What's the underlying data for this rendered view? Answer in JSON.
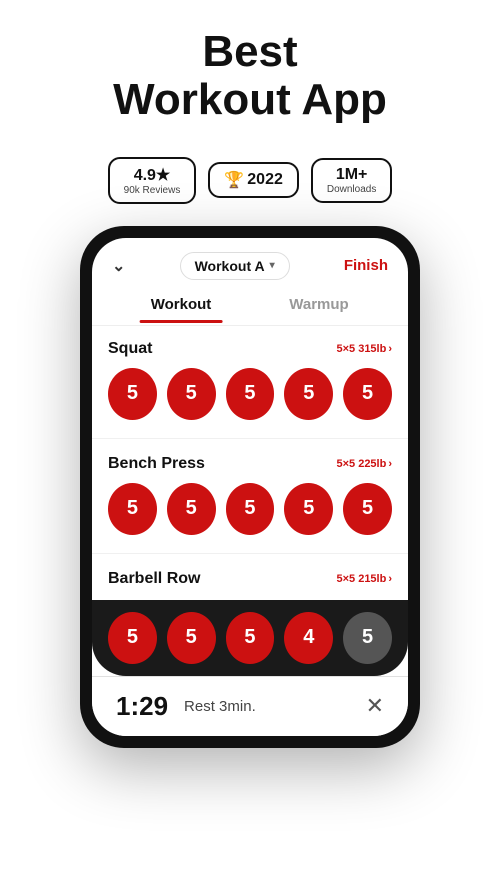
{
  "header": {
    "title_line1": "Best",
    "title_line2": "Workout App"
  },
  "badges": [
    {
      "id": "rating",
      "main": "4.9★",
      "sub": "90k Reviews"
    },
    {
      "id": "award",
      "icon": "🏆",
      "main": "2022",
      "sub": ""
    },
    {
      "id": "downloads",
      "main": "1M+",
      "sub": "Downloads"
    }
  ],
  "phone": {
    "top_bar": {
      "workout_selector": "Workout A",
      "finish_label": "Finish"
    },
    "tabs": [
      {
        "label": "Workout",
        "active": true
      },
      {
        "label": "Warmup",
        "active": false
      }
    ],
    "exercises": [
      {
        "name": "Squat",
        "meta": "5×5 315lb",
        "reps": [
          5,
          5,
          5,
          5,
          5
        ],
        "grey_indices": []
      },
      {
        "name": "Bench Press",
        "meta": "5×5 225lb",
        "reps": [
          5,
          5,
          5,
          5,
          5
        ],
        "grey_indices": []
      },
      {
        "name": "Barbell Row",
        "meta": "5×5 215lb",
        "reps": [
          5,
          5,
          5,
          4,
          5
        ],
        "grey_indices": [
          4
        ]
      }
    ],
    "barbell_row_bottom_reps": [
      5,
      5,
      5,
      4,
      5
    ],
    "rest_timer": {
      "time": "1:29",
      "label": "Rest 3min."
    }
  }
}
